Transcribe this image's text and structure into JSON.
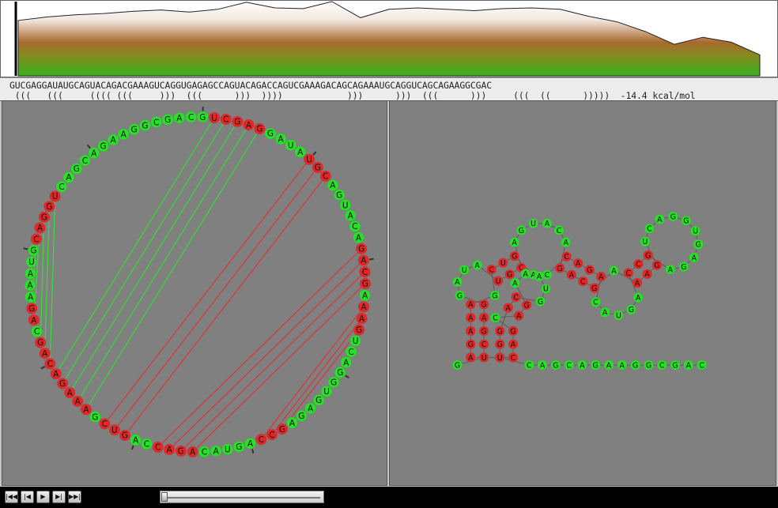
{
  "sequence": "GUCGAGGAUAUGCAGUACAGACGAAAGUCAGGUGAGAGCCAGUACAGACCAGUCGAAAGACAGCAGAAAUGCAGGUCAGCAGAAGGCGAC",
  "structure": " (((   (((     (((( (((     )))  (((      )))  ))))            )))      )))  (((      )))     (((  ((      )))))  -14.4 kcal/mol",
  "energy": "-14.4 kcal/mol",
  "plot_values": [
    79,
    84,
    87,
    89,
    92,
    94,
    91,
    95,
    105,
    97,
    96,
    106,
    83,
    95,
    97,
    95,
    93,
    96,
    97,
    95,
    85,
    77,
    63,
    45,
    55,
    48,
    30
  ],
  "pairs": [
    [
      1,
      59
    ],
    [
      2,
      58
    ],
    [
      3,
      57
    ],
    [
      4,
      56
    ],
    [
      5,
      55
    ],
    [
      10,
      53
    ],
    [
      11,
      52
    ],
    [
      12,
      51
    ],
    [
      19,
      48
    ],
    [
      20,
      47
    ],
    [
      21,
      46
    ],
    [
      22,
      45
    ],
    [
      24,
      39
    ],
    [
      25,
      38
    ],
    [
      26,
      37
    ],
    [
      60,
      75
    ],
    [
      61,
      74
    ],
    [
      62,
      73
    ],
    [
      64,
      72
    ],
    [
      65,
      71
    ]
  ],
  "colors": {
    "unpaired": "#28e028",
    "paired": "#e02828",
    "pair_line_left": "#39d939",
    "pair_line_right": "#d23a3a",
    "panel": "#808080"
  },
  "controls": {
    "first": "first-icon",
    "prev": "prev-icon",
    "play": "play-icon",
    "next": "next-icon",
    "last": "last-icon",
    "slider_position": 0.0
  }
}
